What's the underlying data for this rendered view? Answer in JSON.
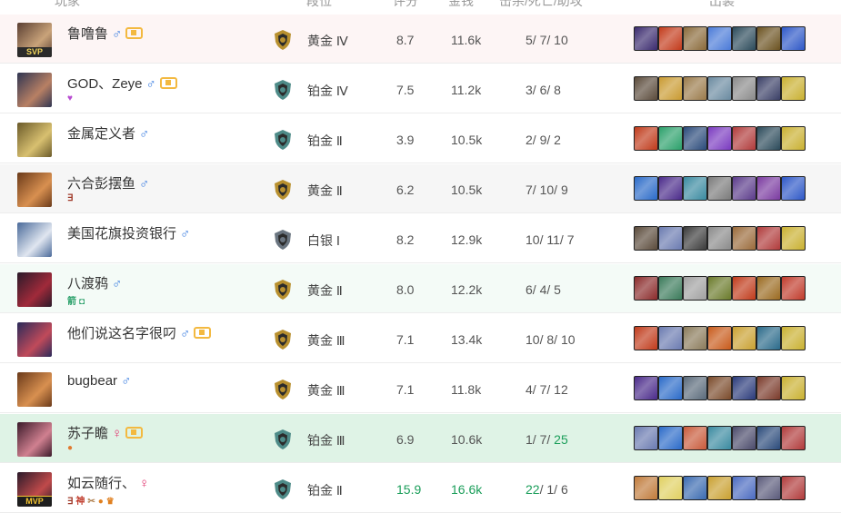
{
  "header": {
    "player": "玩家",
    "rank": "段位",
    "score": "评分",
    "gold": "金钱",
    "kda": "击杀/死亡/助攻",
    "items": "出装"
  },
  "rows": [
    {
      "name": "鲁噜鲁",
      "gender": "♂",
      "fame": true,
      "tag": "SVP",
      "avatar": [
        "#5a3f33",
        "#c9a37a"
      ],
      "sub": [],
      "rank_color": "#b8902f",
      "rank": "黄金 Ⅳ",
      "score": "8.7",
      "gold": "11.6k",
      "k": "5",
      "d": "7",
      "a": "10",
      "green_score": false,
      "green_gold": false,
      "green_k": false,
      "green_a": false,
      "bg": "lose",
      "items": [
        "#3a2a6e",
        "#c33a1a",
        "#8a6a3a",
        "#4a7ad8",
        "#2b4a5a",
        "#6b5220",
        "#2d57c7"
      ]
    },
    {
      "name": "GOD、Zeye",
      "gender": "♂",
      "fame": true,
      "tag": "",
      "avatar": [
        "#2f3552",
        "#b88064"
      ],
      "sub": [
        {
          "t": "♥",
          "c": "#b84bd1"
        }
      ],
      "rank_color": "#4e8b88",
      "rank": "铂金 Ⅳ",
      "score": "7.5",
      "gold": "11.2k",
      "k": "3",
      "d": "6",
      "a": "8",
      "green_score": false,
      "green_gold": false,
      "green_k": false,
      "green_a": false,
      "bg": "white",
      "items": [
        "#5a4a3a",
        "#c99a30",
        "#9a7a4a",
        "#6a8aa0",
        "#8a8a8a",
        "#3a3f66",
        "#c9b030"
      ]
    },
    {
      "name": "金属定义者",
      "gender": "♂",
      "fame": false,
      "tag": "",
      "avatar": [
        "#6a5a2a",
        "#d8c070"
      ],
      "sub": [],
      "rank_color": "#4e8b88",
      "rank": "铂金 Ⅱ",
      "score": "3.9",
      "gold": "10.5k",
      "k": "2",
      "d": "9",
      "a": "2",
      "green_score": false,
      "green_gold": false,
      "green_k": false,
      "green_a": false,
      "bg": "white",
      "items": [
        "#c03a1a",
        "#2aa06a",
        "#2a4a7a",
        "#7a3ac0",
        "#b03a3a",
        "#2b4a5a",
        "#c9b030"
      ]
    },
    {
      "name": "六合彭摆鱼",
      "gender": "♂",
      "fame": false,
      "tag": "",
      "avatar": [
        "#6a3a1a",
        "#d89050"
      ],
      "sub": [
        {
          "t": "∃",
          "c": "#a03a2a"
        }
      ],
      "rank_color": "#b8902f",
      "rank": "黄金 Ⅱ",
      "score": "6.2",
      "gold": "10.5k",
      "k": "7",
      "d": "10",
      "a": "9",
      "green_score": false,
      "green_gold": false,
      "green_k": false,
      "green_a": false,
      "bg": "gray",
      "items": [
        "#2a6ac8",
        "#4a2a8a",
        "#3a8aa0",
        "#7a7a7a",
        "#5a3a8a",
        "#7a3aa0",
        "#2d57c7"
      ]
    },
    {
      "name": "美国花旗投资银行",
      "gender": "♂",
      "fame": false,
      "tag": "",
      "avatar": [
        "#4a6a9a",
        "#e0e6f0"
      ],
      "sub": [],
      "rank_color": "#6a7580",
      "rank": "白银 Ⅰ",
      "score": "8.2",
      "gold": "12.9k",
      "k": "10",
      "d": "11",
      "a": "7",
      "green_score": false,
      "green_gold": false,
      "green_k": false,
      "green_a": false,
      "bg": "white",
      "items": [
        "#5a4a3a",
        "#6a7ab0",
        "#3a3a3a",
        "#8a8a8a",
        "#9a6a3a",
        "#b03a3a",
        "#c9b030"
      ]
    },
    {
      "name": "八渡鸦",
      "gender": "♂",
      "fame": false,
      "tag": "",
      "avatar": [
        "#2a1a2a",
        "#a02a3a"
      ],
      "sub": [
        {
          "t": "箭",
          "c": "#2aa06a"
        },
        {
          "t": "◘",
          "c": "#2aa06a"
        }
      ],
      "rank_color": "#b8902f",
      "rank": "黄金 Ⅱ",
      "score": "8.0",
      "gold": "12.2k",
      "k": "6",
      "d": "4",
      "a": "5",
      "green_score": false,
      "green_gold": false,
      "green_k": false,
      "green_a": false,
      "bg": "win",
      "items": [
        "#8a2a2a",
        "#3a7a5a",
        "#a0a0a0",
        "#6a7a2a",
        "#c03a1a",
        "#9a6a20",
        "#c03a2a"
      ]
    },
    {
      "name": "他们说这名字很叼",
      "gender": "♂",
      "fame": true,
      "tag": "",
      "avatar": [
        "#2a2a5a",
        "#c04a5a"
      ],
      "sub": [],
      "rank_color": "#b8902f",
      "rank": "黄金 Ⅲ",
      "score": "7.1",
      "gold": "13.4k",
      "k": "10",
      "d": "8",
      "a": "10",
      "green_score": false,
      "green_gold": false,
      "green_k": false,
      "green_a": false,
      "bg": "white",
      "items": [
        "#c03a1a",
        "#6a7ab0",
        "#8a7a5a",
        "#c85a1a",
        "#c9a030",
        "#2a6a8a",
        "#c9b030"
      ]
    },
    {
      "name": "bugbear",
      "gender": "♂",
      "fame": false,
      "tag": "",
      "avatar": [
        "#6a3a1a",
        "#d89050"
      ],
      "sub": [],
      "rank_color": "#b8902f",
      "rank": "黄金 Ⅲ",
      "score": "7.1",
      "gold": "11.8k",
      "k": "4",
      "d": "7",
      "a": "12",
      "green_score": false,
      "green_gold": false,
      "green_k": false,
      "green_a": false,
      "bg": "white",
      "items": [
        "#4a2a8a",
        "#2a6ac8",
        "#5a6a7a",
        "#7a4a2a",
        "#2a3a7a",
        "#7a3a2a",
        "#c9b030"
      ]
    },
    {
      "name": "苏子瞻",
      "gender": "♀",
      "fame": true,
      "tag": "",
      "avatar": [
        "#3a1a2a",
        "#d08090"
      ],
      "sub": [
        {
          "t": "●",
          "c": "#e07a30"
        }
      ],
      "rank_color": "#4e8b88",
      "rank": "铂金 Ⅲ",
      "score": "6.9",
      "gold": "10.6k",
      "k": "1",
      "d": "7",
      "a": "25",
      "green_score": false,
      "green_gold": false,
      "green_k": false,
      "green_a": true,
      "bg": "hl",
      "items": [
        "#6a7ab0",
        "#2a6ac8",
        "#c85a3a",
        "#3a8aa0",
        "#4a4a6a",
        "#2a4a7a",
        "#b03a3a"
      ]
    },
    {
      "name": "如云随行、",
      "gender": "♀",
      "fame": false,
      "tag": "MVP",
      "avatar": [
        "#2a1a2a",
        "#c04a4a"
      ],
      "sub": [
        {
          "t": "∃",
          "c": "#a03a2a"
        },
        {
          "t": "神",
          "c": "#c03a2a"
        },
        {
          "t": "✂",
          "c": "#b08050"
        },
        {
          "t": "●",
          "c": "#e08020"
        },
        {
          "t": "♛",
          "c": "#e08020"
        }
      ],
      "rank_color": "#4e8b88",
      "rank": "铂金 Ⅱ",
      "score": "15.9",
      "gold": "16.6k",
      "k": "22",
      "d": "1",
      "a": "6",
      "green_score": true,
      "green_gold": true,
      "green_k": true,
      "green_a": false,
      "bg": "white",
      "items": [
        "#c07a3a",
        "#e0d060",
        "#3a6ab0",
        "#c9a030",
        "#4a6ac0",
        "#5a5a7a",
        "#b03a3a"
      ]
    }
  ]
}
